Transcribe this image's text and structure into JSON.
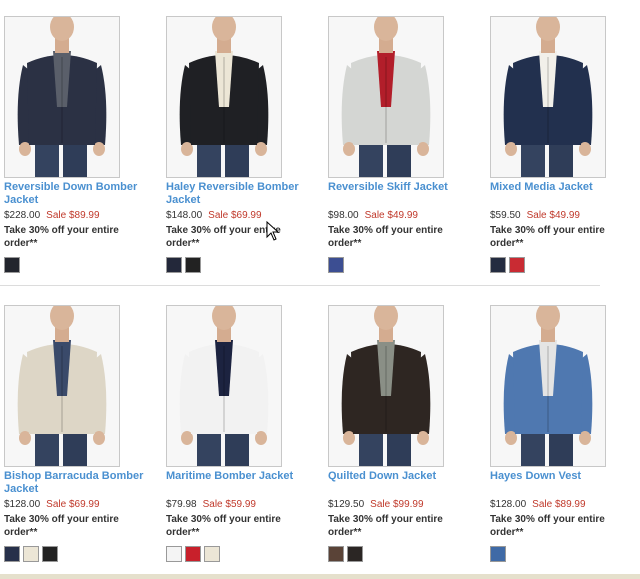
{
  "products": [
    {
      "name": "Reversible Down Bomber Jacket",
      "price": "$228.00",
      "sale": "Sale $89.99",
      "promo_line1": "Take 30% off your entire",
      "promo_line2": "order**",
      "jacket_color": "#2b3144",
      "accent": "#5a5f6a",
      "swatches": [
        "#22252d"
      ]
    },
    {
      "name": "Haley Reversible Bomber Jacket",
      "price": "$148.00",
      "sale": "Sale $69.99",
      "promo_line1": "Take 30% off your entire",
      "promo_line2": "order**",
      "jacket_color": "#1f2024",
      "accent": "#ece6d6",
      "swatches": [
        "#23283a",
        "#222222"
      ]
    },
    {
      "name": "Reversible Skiff Jacket",
      "price": "$98.00",
      "sale": "Sale $49.99",
      "promo_line1": "Take 30% off your entire",
      "promo_line2": "order**",
      "jacket_color": "#d4d6d3",
      "accent": "#b21e2a",
      "swatches": [
        "#3c4e92"
      ]
    },
    {
      "name": "Mixed Media Jacket",
      "price": "$59.50",
      "sale": "Sale $49.99",
      "promo_line1": "Take 30% off your entire",
      "promo_line2": "order**",
      "jacket_color": "#22304e",
      "accent": "#f2f0ea",
      "swatches": [
        "#242c40",
        "#c92b33"
      ]
    },
    {
      "name": "Bishop Barracuda Bomber Jacket",
      "price": "$128.00",
      "sale": "Sale $69.99",
      "promo_line1": "Take 30% off your entire",
      "promo_line2": "order**",
      "jacket_color": "#ddd6c6",
      "accent": "#3a4a6a",
      "swatches": [
        "#27304a",
        "#ece6d6",
        "#222222"
      ]
    },
    {
      "name": "Maritime Bomber Jacket",
      "price": "$79.98",
      "sale": "Sale $59.99",
      "promo_line1": "Take 30% off your entire",
      "promo_line2": "order**",
      "jacket_color": "#f2f2f2",
      "accent": "#1c2340",
      "swatches": [
        "#f4f4f4",
        "#c8202b",
        "#ece6d6"
      ]
    },
    {
      "name": "Quilted Down Jacket",
      "price": "$129.50",
      "sale": "Sale $99.99",
      "promo_line1": "Take 30% off your entire",
      "promo_line2": "order**",
      "jacket_color": "#2e2622",
      "accent": "#8a8f86",
      "swatches": [
        "#5a4337",
        "#2b2624"
      ]
    },
    {
      "name": "Hayes Down Vest",
      "price": "$128.00",
      "sale": "Sale $89.99",
      "promo_line1": "Take 30% off your entire",
      "promo_line2": "order**",
      "jacket_color": "#4f78b0",
      "accent": "#e4e4e4",
      "swatches": [
        "#3f6aa6"
      ]
    }
  ]
}
